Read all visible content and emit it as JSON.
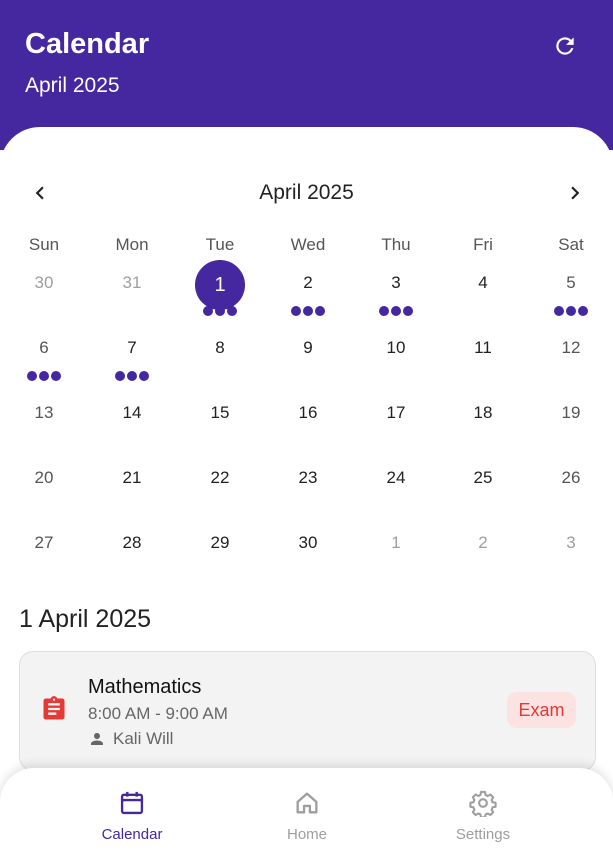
{
  "header": {
    "title": "Calendar",
    "subtitle": "April 2025",
    "refresh_icon": "refresh-icon"
  },
  "calendar": {
    "month_label": "April 2025",
    "prev_icon": "chevron-left-icon",
    "next_icon": "chevron-right-icon",
    "weekdays": [
      "Sun",
      "Mon",
      "Tue",
      "Wed",
      "Thu",
      "Fri",
      "Sat"
    ],
    "weeks": [
      [
        "30",
        "31",
        "1",
        "2",
        "3",
        "4",
        "5"
      ],
      [
        "6",
        "7",
        "8",
        "9",
        "10",
        "11",
        "12"
      ],
      [
        "13",
        "14",
        "15",
        "16",
        "17",
        "18",
        "19"
      ],
      [
        "20",
        "21",
        "22",
        "23",
        "24",
        "25",
        "26"
      ],
      [
        "27",
        "28",
        "29",
        "30",
        "1",
        "2",
        "3"
      ]
    ],
    "selected_date": "1",
    "event_dot_days": [
      "1",
      "2",
      "3",
      "5",
      "6",
      "7"
    ],
    "accent_color": "#4527a0"
  },
  "events_section": {
    "date_heading": "1 April 2025",
    "events": [
      {
        "title": "Mathematics",
        "time": "8:00 AM - 9:00 AM",
        "person": "Kali Will",
        "badge": "Exam",
        "icon": "clipboard-icon",
        "badge_color": "#e53935"
      }
    ]
  },
  "bottom_nav": {
    "items": [
      {
        "label": "Calendar",
        "icon": "calendar-icon",
        "active": true
      },
      {
        "label": "Home",
        "icon": "home-icon",
        "active": false
      },
      {
        "label": "Settings",
        "icon": "settings-icon",
        "active": false
      }
    ]
  }
}
